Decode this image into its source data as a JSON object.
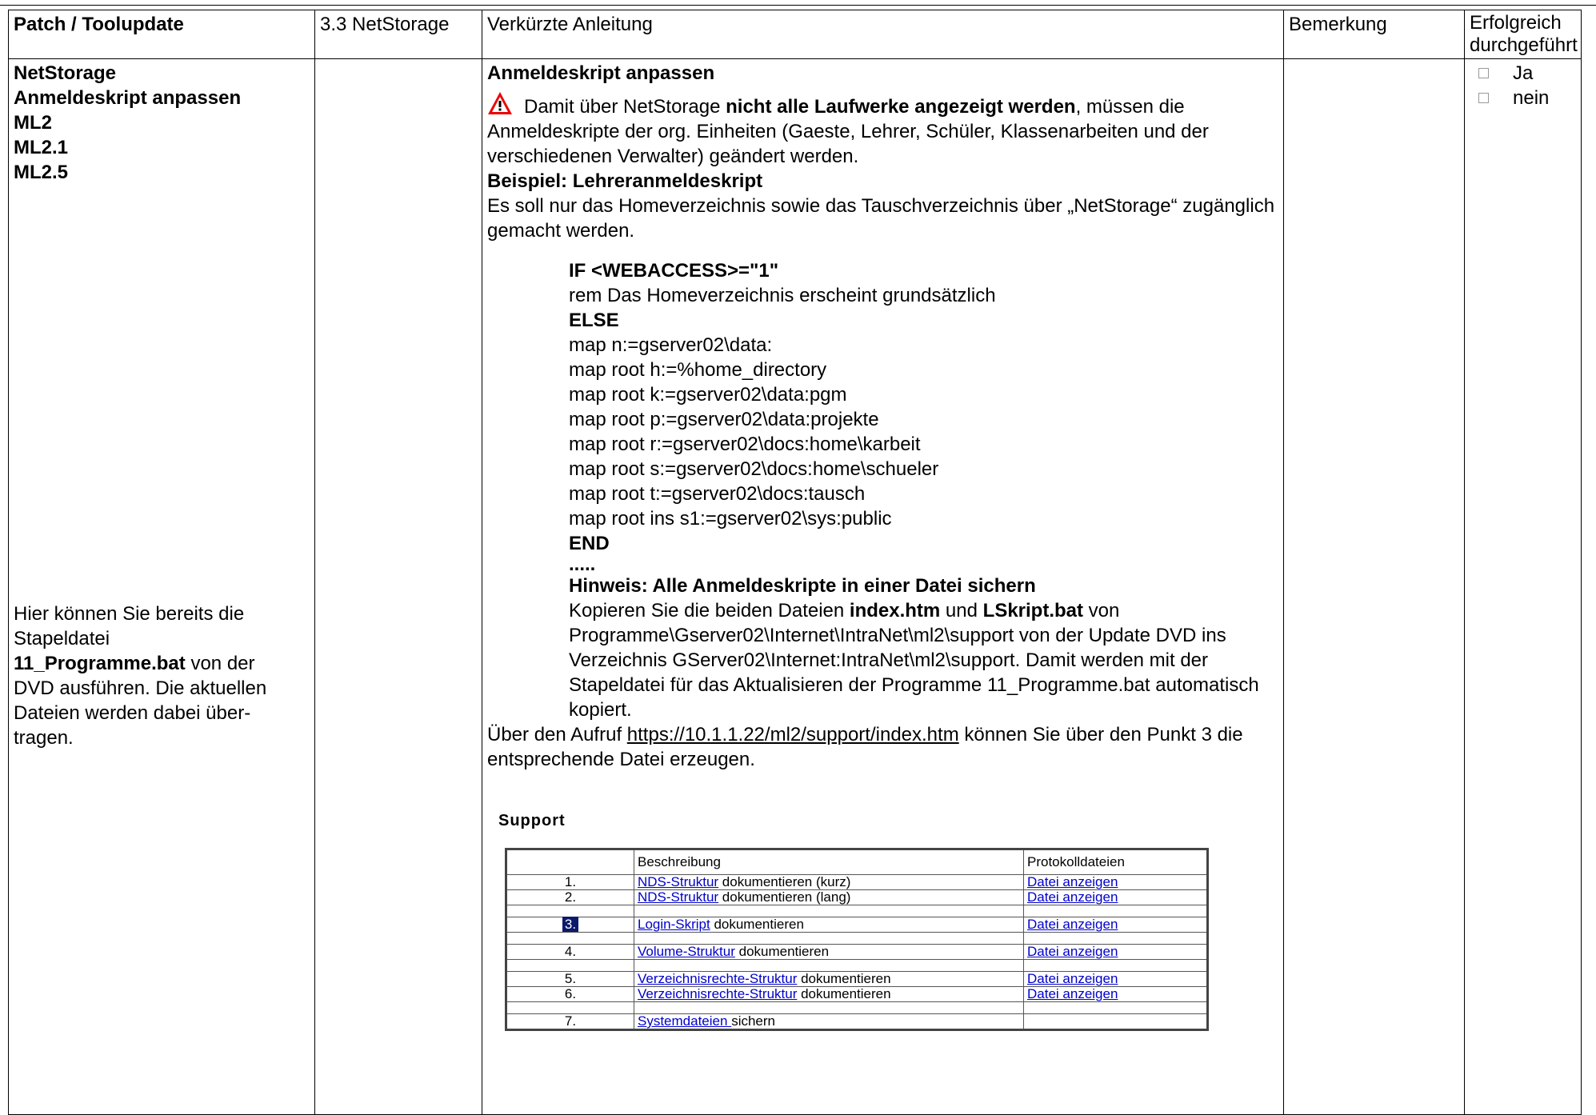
{
  "header": {
    "col1": "Patch / Toolupdate",
    "col2": "3.3 NetStorage",
    "col3": "Verkürzte Anleitung",
    "col4": "Bemerkung",
    "col5": "Erfolgreich durchgeführt"
  },
  "left": {
    "title_lines": [
      "NetStorage",
      "Anmeldeskript anpassen",
      "ML2",
      "ML2.1",
      "ML2.5"
    ],
    "note_a": "Hier können Sie bereits die Stapeldatei ",
    "note_bold": "11_Programme.bat",
    "note_b": " von der DVD ausführen. Die aktuellen Dateien werden dabei über-tragen."
  },
  "checkboxes": [
    "Ja",
    "nein"
  ],
  "content": {
    "title": "Anmeldeskript anpassen",
    "p1_a": "Damit über NetStorage ",
    "p1_bold": "nicht alle Laufwerke angezeigt werden",
    "p1_b": ", müssen die Anmeldeskripte der org. Einheiten (Gaeste, Lehrer, Schüler, Klassenarbeiten und der verschiedenen Verwalter) geändert werden.",
    "example_title": "Beispiel: Lehreranmeldeskript",
    "example_text": "Es soll nur das Homeverzeichnis sowie das Tauschverzeichnis über „NetStorage“ zugänglich gemacht werden.",
    "code": [
      {
        "text": "IF <WEBACCESS>=\"1\"",
        "bold": true
      },
      {
        "text": "rem Das Homeverzeichnis erscheint grundsätzlich",
        "bold": false
      },
      {
        "text": "ELSE",
        "bold": true
      },
      {
        "text": "map n:=gserver02\\data:",
        "bold": false
      },
      {
        "text": "map root h:=%home_directory",
        "bold": false
      },
      {
        "text": "map root k:=gserver02\\data:pgm",
        "bold": false
      },
      {
        "text": "map root p:=gserver02\\data:projekte",
        "bold": false
      },
      {
        "text": "map root r:=gserver02\\docs:home\\karbeit",
        "bold": false
      },
      {
        "text": "map root s:=gserver02\\docs:home\\schueler",
        "bold": false
      },
      {
        "text": "map root t:=gserver02\\docs:tausch",
        "bold": false
      },
      {
        "text": "map root ins s1:=gserver02\\sys:public",
        "bold": false
      },
      {
        "text": "END",
        "bold": true
      },
      {
        "text": ".....",
        "bold": true
      }
    ],
    "hint_title": "Hinweis: Alle Anmeldeskripte in einer Datei sichern",
    "hint_a": "Kopieren Sie die beiden Dateien ",
    "hint_b1": "index.htm",
    "hint_c": " und ",
    "hint_b2": "LSkript.bat",
    "hint_d": " von Programme\\Gserver02\\Internet\\IntraNet\\ml2\\support von der Update DVD ins Verzeichnis GServer02\\Internet:IntraNet\\ml2\\support. Damit werden mit der Stapeldatei für das Aktualisieren der Programme 11_Programme.bat automatisch kopiert.",
    "url_a": "Über den Aufruf ",
    "url": "https://10.1.1.22/ml2/support/index.htm",
    "url_b": " können Sie über den Punkt 3 die entsprechende Datei erzeugen."
  },
  "support": {
    "title": "Support",
    "col_desc": "Beschreibung",
    "col_prot": "Protokolldateien",
    "rows": [
      {
        "num": "1.",
        "link": "NDS-Struktur",
        "rest": " dokumentieren (kurz)",
        "prot": "Datei anzeigen"
      },
      {
        "num": "2.",
        "link": "NDS-Struktur",
        "rest": " dokumentieren (lang)",
        "prot": "Datei anzeigen"
      },
      {
        "num": "3.",
        "link": "Login-Skript",
        "rest": " dokumentieren",
        "prot": "Datei anzeigen"
      },
      {
        "num": "4.",
        "link": "Volume-Struktur",
        "rest": " dokumentieren",
        "prot": "Datei anzeigen"
      },
      {
        "num": "5.",
        "link": "Verzeichnisrechte-Struktur",
        "rest": " dokumentieren",
        "prot": "Datei anzeigen"
      },
      {
        "num": "6.",
        "link": "Verzeichnisrechte-Struktur",
        "rest": " dokumentieren",
        "prot": "Datei anzeigen"
      },
      {
        "num": "7.",
        "link": "Systemdateien ",
        "rest": "sichern",
        "prot": ""
      }
    ]
  }
}
